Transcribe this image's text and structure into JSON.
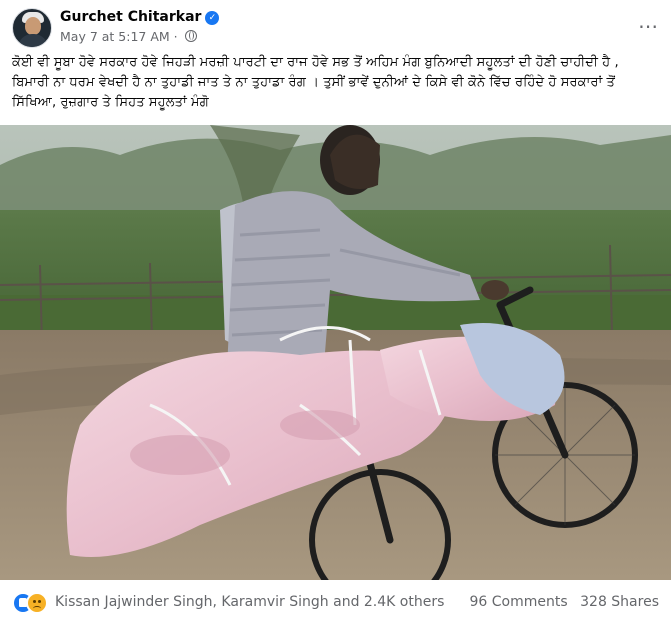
{
  "post": {
    "author": "Gurchet Chitarkar",
    "timestamp": "May 7 at 5:17 AM",
    "meta_separator": "·",
    "more_icon": "⋯",
    "caption": "ਕੋਈ ਵੀ ਸੂਬਾ ਹੋਵੇ ਸਰਕਾਰ ਹੋਵੇ ਜਿਹੜੀ ਮਰਜ਼ੀ ਪਾਰਟੀ ਦਾ ਰਾਜ ਹੋਵੇ ਸਭ ਤੋਂ ਅਹਿਮ ਮੰਗ ਬੁਨਿਆਦੀ ਸਹੂਲਤਾਂ ਦੀ ਹੋਣੀ ਚਾਹੀਦੀ ਹੈ , ਬਿਮਾਰੀ ਨਾ ਧਰਮ ਵੇਖਦੀ ਹੈ ਨਾ ਤੁਹਾਡੀ ਜਾਤ ਤੇ ਨਾ ਤੁਹਾਡਾ ਰੰਗ । ਤੁਸੀਂ ਭਾਵੇਂ ਦੁਨੀਆਂ ਦੇ ਕਿਸੇ ਵੀ ਕੋਨੇ ਵਿੱਚ ਰਹਿੰਦੇ ਹੋ ਸਰਕਾਰਾਂ ਤੋਂ ਸਿੱਖਿਆ, ਰੁਜ਼ਗਾਰ ਤੇ ਸਿਹਤ ਸਹੂਲਤਾਂ ਮੰਗੋ"
  },
  "footer": {
    "reaction_names": "Kissan Jajwinder Singh, Karamvir Singh and 2.4K others",
    "comments": "96 Comments",
    "shares": "328 Shares"
  },
  "colors": {
    "accent": "#1877f2",
    "secondary_text": "#65676b"
  },
  "icons": {
    "verified": "verified-badge-icon",
    "audience": "globe-icon",
    "like": "like-reaction-icon",
    "sad": "sad-reaction-icon"
  }
}
